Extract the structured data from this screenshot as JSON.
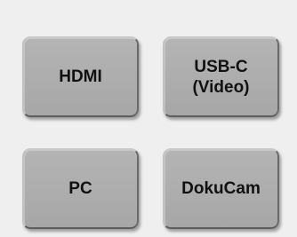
{
  "sources": [
    {
      "label": "HDMI"
    },
    {
      "label": "USB-C\n(Video)"
    },
    {
      "label": "PC"
    },
    {
      "label": "DokuCam"
    }
  ],
  "colors": {
    "background": "#efefef",
    "button_face": "#adadad",
    "button_text": "#111111"
  }
}
